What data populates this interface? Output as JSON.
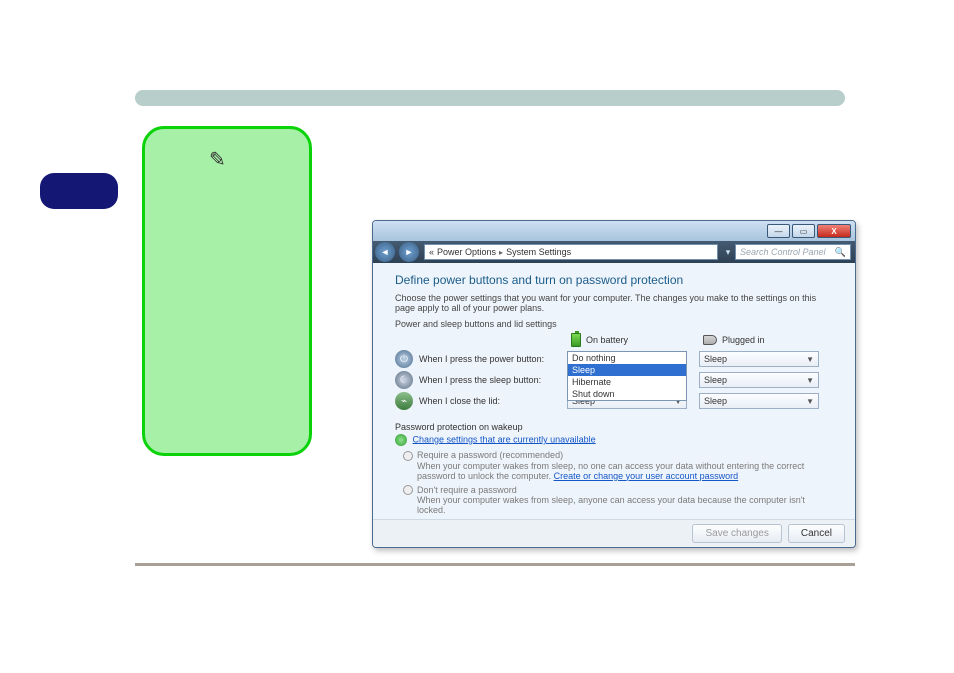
{
  "crumbs": {
    "root_indicator": "«",
    "a": "Power Options",
    "b": "System Settings",
    "sep": "▸"
  },
  "search_placeholder": "Search Control Panel",
  "title": "Define power buttons and turn on password protection",
  "description": "Choose the power settings that you want for your computer. The changes you make to the settings on this page apply to all of your power plans.",
  "section": "Power and sleep buttons and lid settings",
  "cols": {
    "battery": "On battery",
    "plugged": "Plugged in"
  },
  "rows": [
    {
      "label": "When I press the power button:",
      "batt": "Sleep",
      "plug": "Sleep"
    },
    {
      "label": "When I press the sleep button:",
      "batt": "Sleep",
      "plug": "Sleep"
    },
    {
      "label": "When I close the lid:",
      "batt": "Sleep",
      "plug": "Sleep"
    }
  ],
  "dropdown_options": [
    "Do nothing",
    "Sleep",
    "Hibernate",
    "Shut down"
  ],
  "dropdown_selected": "Sleep",
  "pwp": {
    "heading": "Password protection on wakeup",
    "change_link": "Change settings that are currently unavailable",
    "opt1_head": "Require a password (recommended)",
    "opt1_body_a": "When your computer wakes from sleep, no one can access your data without entering the correct password to unlock the computer. ",
    "opt1_link": "Create or change your user account password",
    "opt2_head": "Don't require a password",
    "opt2_body": "When your computer wakes from sleep, anyone can access your data because the computer isn't locked."
  },
  "buttons": {
    "save": "Save changes",
    "cancel": "Cancel"
  },
  "winbtn": {
    "min": "—",
    "max": "▭",
    "close": "X"
  }
}
